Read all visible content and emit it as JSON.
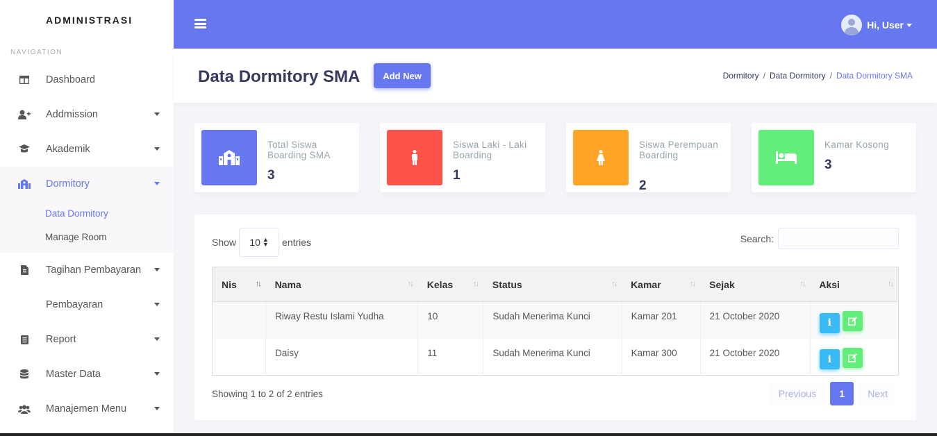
{
  "sidebar": {
    "brand": "ADMINISTRASI",
    "heading": "NAVIGATION",
    "items": [
      {
        "label": "Dashboard",
        "icon": "columns-icon"
      },
      {
        "label": "Addmission",
        "icon": "user-plus-icon"
      },
      {
        "label": "Akademik",
        "icon": "graduation-cap-icon"
      },
      {
        "label": "Dormitory",
        "icon": "school-icon"
      },
      {
        "label": "Tagihan Pembayaran",
        "icon": "file-invoice-icon"
      },
      {
        "label": "Pembayaran",
        "icon": ""
      },
      {
        "label": "Report",
        "icon": "report-icon"
      },
      {
        "label": "Master Data",
        "icon": "database-icon"
      },
      {
        "label": "Manajemen Menu",
        "icon": "users-cog-icon"
      }
    ],
    "sub_items": [
      {
        "label": "Data Dormitory"
      },
      {
        "label": "Manage Room"
      }
    ]
  },
  "navbar": {
    "user_label": "Hi, User"
  },
  "header": {
    "title": "Data Dormitory SMA",
    "add_button": "Add New",
    "breadcrumb": [
      "Dormitory",
      "Data Dormitory",
      "Data Dormitory SMA"
    ]
  },
  "stats": [
    {
      "label": "Total Siswa Boarding SMA",
      "value": "3",
      "color": "#6777ef",
      "icon": "school-icon"
    },
    {
      "label": "Siswa Laki - Laki Boarding",
      "value": "1",
      "color": "#fc544b",
      "icon": "male-icon"
    },
    {
      "label": "Siswa Perempuan Boarding",
      "value": "2",
      "color": "#ffa426",
      "icon": "female-icon"
    },
    {
      "label": "Kamar Kosong",
      "value": "3",
      "color": "#63ed7a",
      "icon": "bed-icon"
    }
  ],
  "table": {
    "show_label": "Show",
    "entries_value": "10",
    "entries_label": "entries",
    "search_label": "Search:",
    "columns": [
      "Nis",
      "Nama",
      "Kelas",
      "Status",
      "Kamar",
      "Sejak",
      "Aksi"
    ],
    "rows": [
      {
        "nis": "",
        "nama": "Riway Restu Islami Yudha",
        "kelas": "10",
        "status": "Sudah Menerima Kunci",
        "kamar": "Kamar 201",
        "sejak": "21 October 2020"
      },
      {
        "nis": "",
        "nama": "Daisy",
        "kelas": "11",
        "status": "Sudah Menerima Kunci",
        "kamar": "Kamar 300",
        "sejak": "21 October 2020"
      }
    ],
    "info": "Showing 1 to 2 of 2 entries",
    "pagination": {
      "previous": "Previous",
      "current": "1",
      "next": "Next"
    }
  }
}
